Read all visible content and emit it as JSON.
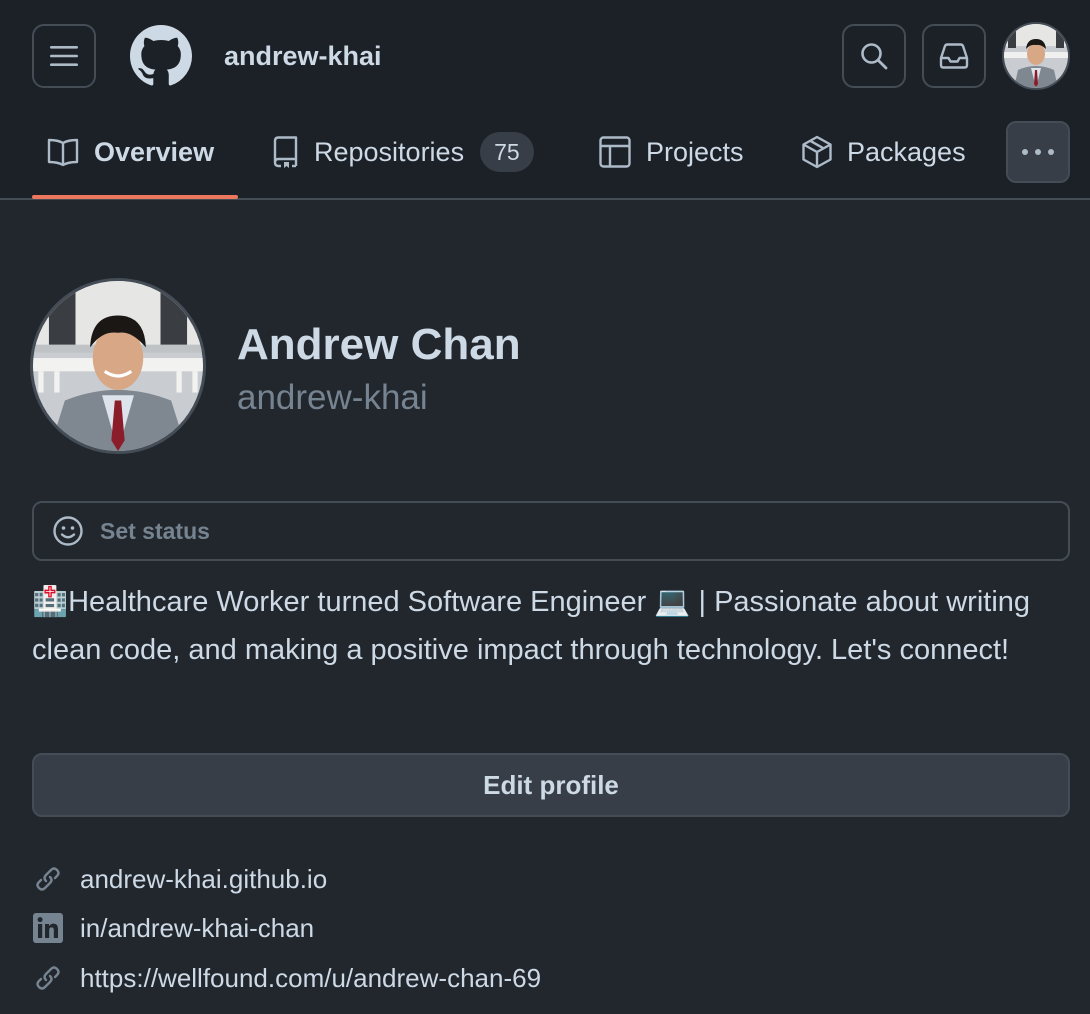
{
  "header": {
    "title": "andrew-khai",
    "icons": {
      "menu": "hamburger-menu-icon",
      "logo": "github-logo",
      "search": "search-icon",
      "inbox": "inbox-icon"
    }
  },
  "nav": {
    "tabs": [
      {
        "label": "Overview",
        "icon": "book-icon",
        "active": true
      },
      {
        "label": "Repositories",
        "icon": "repo-icon",
        "count": "75"
      },
      {
        "label": "Projects",
        "icon": "table-icon"
      },
      {
        "label": "Packages",
        "icon": "package-icon"
      }
    ],
    "accent_color": "#ec775c"
  },
  "profile": {
    "name": "Andrew Chan",
    "login": "andrew-khai",
    "status_placeholder": "Set status",
    "bio": {
      "emoji_start": "🏥",
      "part1": "Healthcare Worker turned Software Engineer ",
      "emoji_mid": "💻",
      "part2": " | Passionate about writing clean code, and making a positive impact through technology. Let's connect!"
    },
    "edit_label": "Edit profile",
    "links": [
      {
        "icon": "link-icon",
        "text": "andrew-khai.github.io"
      },
      {
        "icon": "linkedin-icon",
        "text": "in/andrew-khai-chan"
      },
      {
        "icon": "link-icon",
        "text": "https://wellfound.com/u/andrew-chan-69"
      }
    ]
  }
}
